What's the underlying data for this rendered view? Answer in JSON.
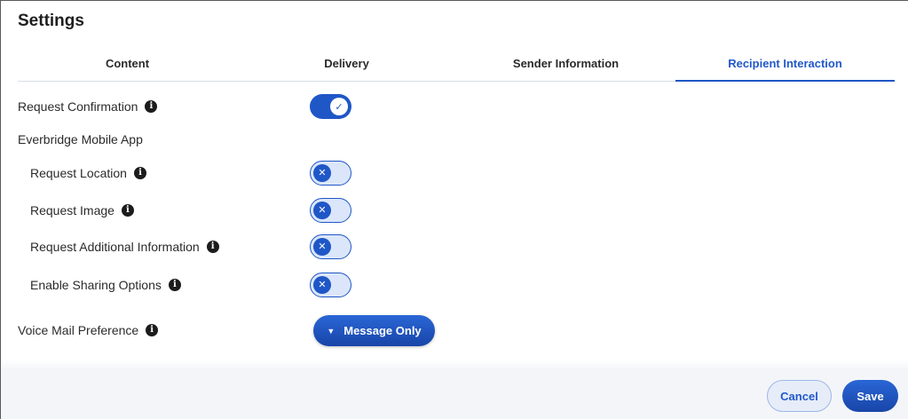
{
  "header": {
    "title": "Settings"
  },
  "tabs": [
    {
      "label": "Content",
      "active": false
    },
    {
      "label": "Delivery",
      "active": false
    },
    {
      "label": "Sender Information",
      "active": false
    },
    {
      "label": "Recipient Interaction",
      "active": true
    }
  ],
  "settings": {
    "request_confirmation": {
      "label": "Request Confirmation",
      "enabled": true,
      "check_glyph": "✓"
    },
    "mobile_app_heading": "Everbridge Mobile App",
    "request_location": {
      "label": "Request Location",
      "enabled": false,
      "x_glyph": "✕"
    },
    "request_image": {
      "label": "Request Image",
      "enabled": false,
      "x_glyph": "✕"
    },
    "request_additional_info": {
      "label": "Request Additional Information",
      "enabled": false,
      "x_glyph": "✕"
    },
    "enable_sharing": {
      "label": "Enable Sharing Options",
      "enabled": false,
      "x_glyph": "✕"
    },
    "voice_mail": {
      "label": "Voice Mail Preference",
      "selected": "Message Only",
      "caret": "▼"
    }
  },
  "info_glyph": "i",
  "footer": {
    "cancel_label": "Cancel",
    "save_label": "Save"
  },
  "colors": {
    "accent": "#1f57c7",
    "tab_active": "#2159c9",
    "toggle_off_bg": "#dbe6fb"
  }
}
